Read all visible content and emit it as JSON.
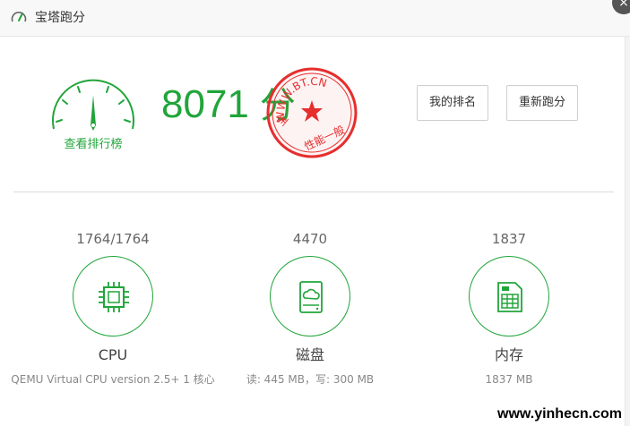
{
  "window": {
    "title": "宝塔跑分",
    "close_label": "×"
  },
  "gauge": {
    "link_label": "查看排行榜"
  },
  "score": {
    "value": "8071",
    "unit": "分"
  },
  "stamp": {
    "arc_text": "WWW.BT.CN",
    "left_text": "宝",
    "bottom_text": "性能一般"
  },
  "buttons": {
    "rank_label": "我的排名",
    "rerun_label": "重新跑分"
  },
  "metrics": {
    "cpu": {
      "value": "1764/1764",
      "name": "CPU",
      "detail": "QEMU Virtual CPU version 2.5+ 1 核心",
      "icon": "chip-icon"
    },
    "disk": {
      "value": "4470",
      "name": "磁盘",
      "detail": "读: 445 MB，写: 300 MB",
      "icon": "disk-cloud-icon"
    },
    "memory": {
      "value": "1837",
      "name": "内存",
      "detail": "1837 MB",
      "icon": "memory-card-icon"
    }
  },
  "watermark": "www.yinhecn.com",
  "colors": {
    "accent": "#20a53a",
    "stamp": "#e62e2e",
    "close_bg": "#555555"
  }
}
